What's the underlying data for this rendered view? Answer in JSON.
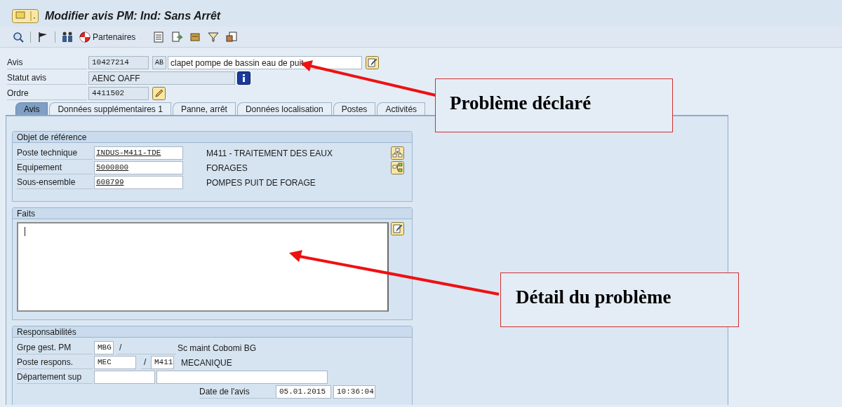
{
  "window": {
    "title": "Modifier avis PM: Ind: Sans Arrêt"
  },
  "toolbar": {
    "partners_button": "Partenaires"
  },
  "header": {
    "avis": {
      "label": "Avis",
      "number": "10427214",
      "type": "AB",
      "description": "clapet pompe de bassin eau de puit"
    },
    "statut": {
      "label": "Statut avis",
      "value": "AENC OAFF"
    },
    "ordre": {
      "label": "Ordre",
      "value": "4411502"
    }
  },
  "tabs": [
    {
      "label": "Avis",
      "selected": true
    },
    {
      "label": "Données supplémentaires 1",
      "selected": false
    },
    {
      "label": "Panne, arrêt",
      "selected": false
    },
    {
      "label": "Données localisation",
      "selected": false
    },
    {
      "label": "Postes",
      "selected": false
    },
    {
      "label": "Activités",
      "selected": false
    }
  ],
  "objet_reference": {
    "title": "Objet de référence",
    "rows": [
      {
        "label": "Poste technique",
        "value": "INDUS-M411-TDE",
        "description": "M411 - TRAITEMENT DES EAUX"
      },
      {
        "label": "Equipement",
        "value": "5000800",
        "description": "FORAGES"
      },
      {
        "label": "Sous-ensemble",
        "value": "608799",
        "description": "POMPES PUIT DE FORAGE"
      }
    ]
  },
  "faits": {
    "title": "Faits"
  },
  "responsabilites": {
    "title": "Responsabilités",
    "grpe_gest": {
      "label": "Grpe gest. PM",
      "value": "MBG",
      "separator": "/",
      "description": "Sc maint Cobomi BG"
    },
    "poste_respons": {
      "label": "Poste respons.",
      "value": "MEC",
      "separator": "/",
      "plant": "M411",
      "description": "MECANIQUE"
    },
    "departement": {
      "label": "Département sup"
    },
    "date": {
      "label": "Date de l'avis",
      "date": "05.01.2015",
      "time": "10:36:04"
    }
  },
  "annotations": [
    {
      "text": "Problème déclaré"
    },
    {
      "text": "Détail du problème"
    }
  ]
}
